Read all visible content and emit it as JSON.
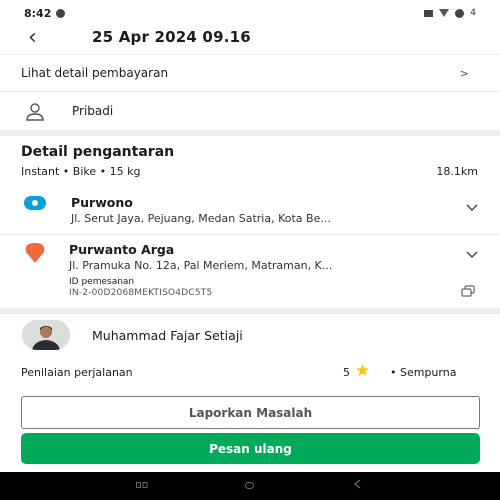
{
  "status_bar": {
    "time": "8:42",
    "battery": "4"
  },
  "header": {
    "back_icon": "‹",
    "title": "25 Apr 2024 09.16"
  },
  "payment_link": {
    "label": "Lihat detail pembayaran",
    "chevron": ">"
  },
  "profile": {
    "label": "Pribadi"
  },
  "delivery": {
    "title": "Detail pengantaran",
    "service": "Instant • Bike • 15 kg",
    "distance": "18.1km",
    "origin": {
      "name": "Purwono",
      "address": "Jl. Serut Jaya, Pejuang, Medan Satria, Kota Be..."
    },
    "destination": {
      "name": "Purwanto Arga",
      "address": "Jl. Pramuka No. 12a, Pal Meriem, Matraman, K..."
    },
    "order_id_label": "ID pemesanan",
    "order_id": "IN-2-00D2068MEKTISO4DC5T5"
  },
  "driver": {
    "name": "Muhammad Fajar Setiaji"
  },
  "rating": {
    "label": "Penilaian perjalanan",
    "value": "5",
    "star": "★",
    "text": "• Sempurna"
  },
  "buttons": {
    "report": "Laporkan Masalah",
    "reorder": "Pesan ulang"
  },
  "colors": {
    "primary_green": "#00aa5b",
    "origin_blue": "#0aa0d8",
    "destination_orange": "#f06a3a",
    "star_yellow": "#f5c518"
  },
  "icons": [
    "back-icon",
    "chevron-right-icon",
    "person-icon",
    "origin-pin-icon",
    "destination-pin-icon",
    "chevron-down-icon",
    "copy-icon",
    "star-icon"
  ]
}
